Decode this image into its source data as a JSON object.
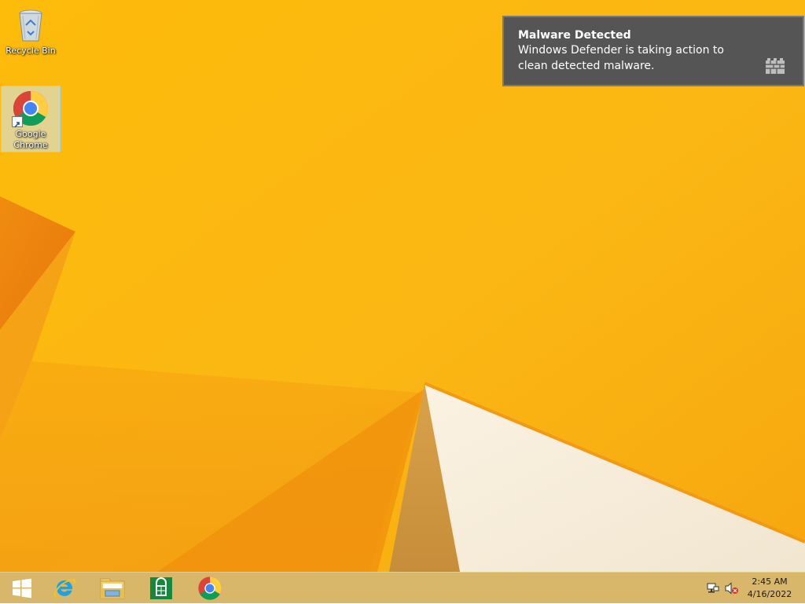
{
  "desktop": {
    "icons": [
      {
        "label": "Recycle Bin",
        "icon": "recycle-bin-icon"
      },
      {
        "label": "Google Chrome",
        "icon": "chrome-icon",
        "selected": true
      }
    ]
  },
  "toast": {
    "title": "Malware Detected",
    "body": "Windows Defender is taking action to clean detected malware.",
    "icon": "windows-defender-icon"
  },
  "taskbar": {
    "pinned": [
      {
        "name": "start-button",
        "icon": "windows-logo-icon"
      },
      {
        "name": "internet-explorer",
        "icon": "internet-explorer-icon"
      },
      {
        "name": "file-explorer",
        "icon": "file-explorer-icon"
      },
      {
        "name": "store",
        "icon": "store-icon"
      },
      {
        "name": "google-chrome",
        "icon": "chrome-icon"
      }
    ],
    "tray": {
      "network_icon": "network-icon",
      "volume_icon": "volume-muted-icon",
      "time": "2:45 AM",
      "date": "4/16/2022"
    }
  },
  "colors": {
    "wallpaper_base": "#fbb710",
    "taskbar": "#d8b66a",
    "toast_bg": "#555555"
  }
}
